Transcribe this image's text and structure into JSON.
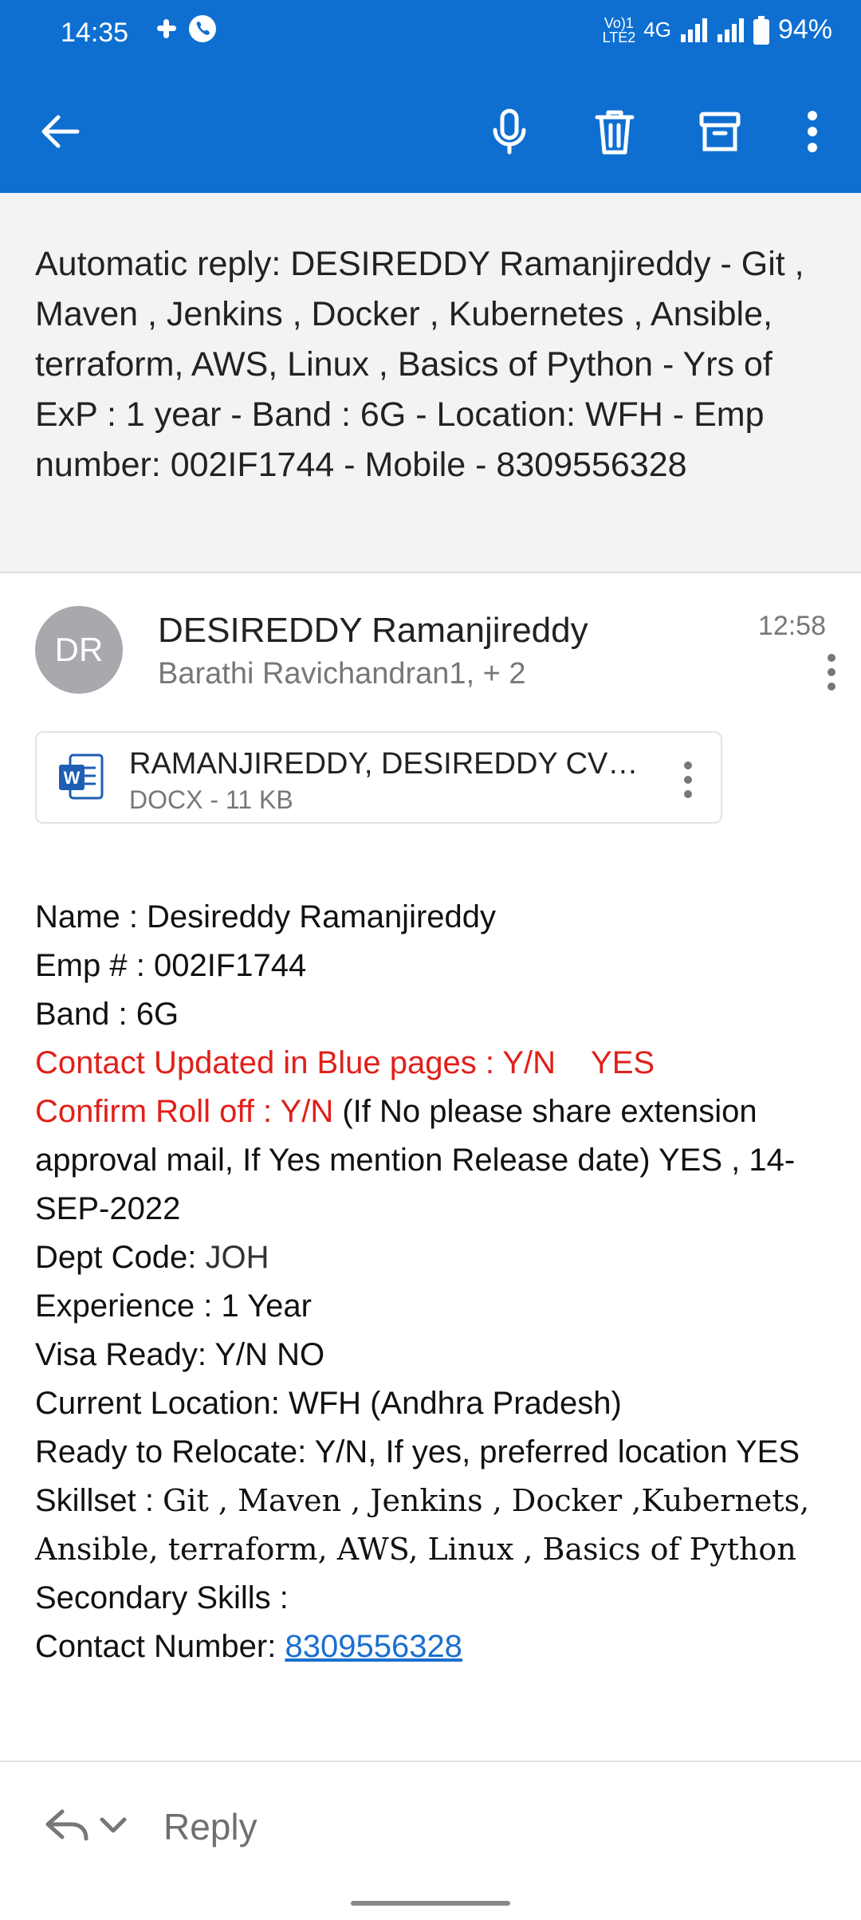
{
  "status": {
    "time": "14:35",
    "battery": "94%",
    "net_top": "Vo)1",
    "net_bottom": "LTE2",
    "network": "4G"
  },
  "subject": "Automatic reply: DESIREDDY Ramanjireddy - Git , Maven , Jenkins , Docker , Kubernetes , Ansible, terraform, AWS, Linux , Basics of Python - Yrs of ExP : 1 year  - Band : 6G - Location: WFH - Emp number: 002IF1744 - Mobile  - 8309556328",
  "message": {
    "avatar_initials": "DR",
    "sender": "DESIREDDY Ramanjireddy",
    "recipients": "Barathi Ravichandran1, + 2",
    "time": "12:58"
  },
  "attachment": {
    "name": "RAMANJIREDDY, DESIREDDY CV…",
    "meta": "DOCX - 11 KB"
  },
  "body": {
    "name_label": "Name :  ",
    "name_value": "Desireddy Ramanjireddy",
    "emp_label": "Emp # : ",
    "emp_value": "002IF1744",
    "band_label": "Band :  ",
    "band_value": "6G",
    "contact_updated": "Contact Updated in Blue pages : Y/N",
    "contact_updated_value": "YES",
    "rolloff_label": "Confirm Roll off : Y/N",
    "rolloff_rest": " (If No please share extension approval mail, If Yes mention Release date) YES , 14-SEP-2022",
    "dept_label": "Dept Code: ",
    "dept_value": "JOH",
    "exp_label": "Experience :  ",
    "exp_value": "1 Year",
    "visa": "Visa Ready: Y/N  NO",
    "location": "Current Location: WFH (Andhra Pradesh)",
    "relocate": "Ready to Relocate: Y/N, If yes, preferred location YES",
    "skill_label": "Skillset : ",
    "skill_value": "Git , Maven , Jenkins , Docker ,Kubernets, Ansible, terraform, AWS, Linux , Basics of Python",
    "secondary_label": "Secondary Skills :",
    "contact_label": "Contact Number:  ",
    "contact_value": "8309556328"
  },
  "reply": {
    "label": "Reply"
  },
  "colors": {
    "brand": "#0f6fd1",
    "alert_red": "#e0201a",
    "link": "#1a6fcf"
  },
  "icons": [
    "back-arrow-icon",
    "microphone-icon",
    "delete-icon",
    "archive-icon",
    "more-options-icon",
    "word-document-icon",
    "reply-icon",
    "chevron-down-icon"
  ]
}
